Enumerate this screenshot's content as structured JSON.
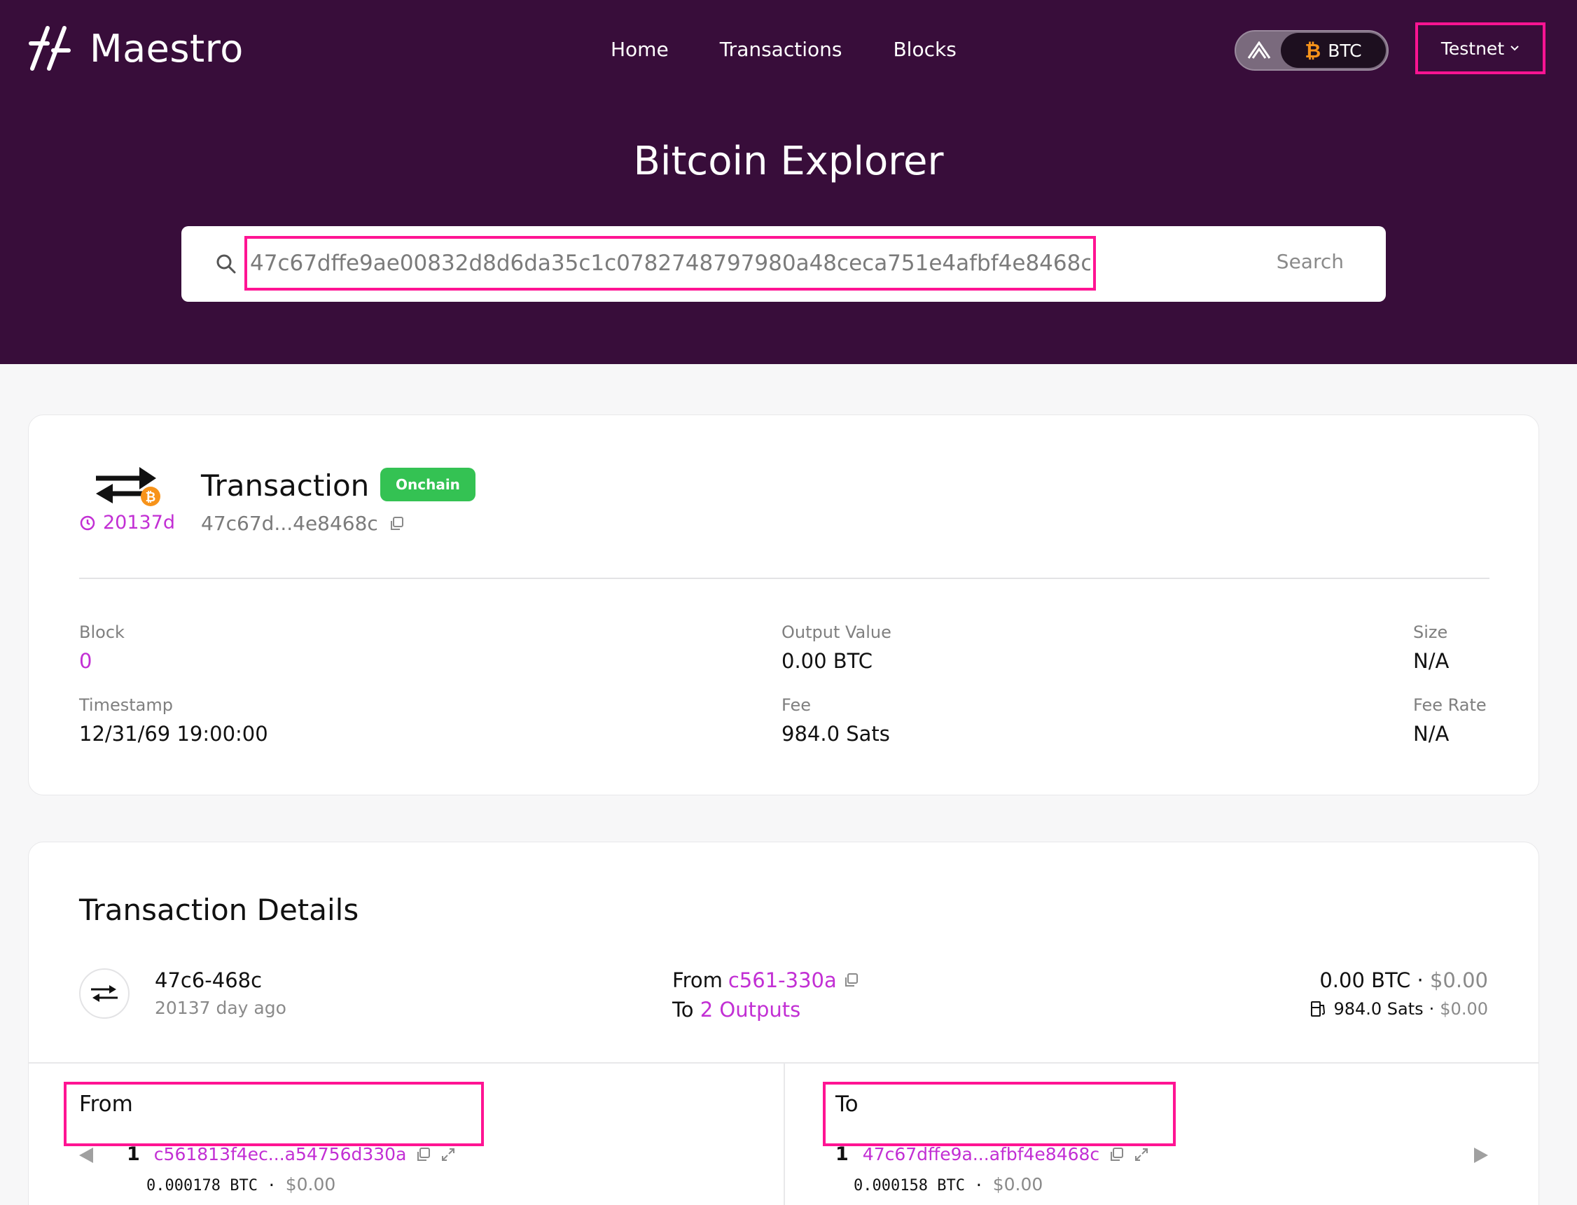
{
  "brand": {
    "name": "Maestro"
  },
  "nav": {
    "home": "Home",
    "transactions": "Transactions",
    "blocks": "Blocks"
  },
  "chain_toggle": {
    "selected": "BTC"
  },
  "network": {
    "selected": "Testnet"
  },
  "page_title": "Bitcoin Explorer",
  "search": {
    "value": "47c67dffe9ae00832d8d6da35c1c0782748797980a48ceca751e4afbf4e8468c",
    "button": "Search"
  },
  "transaction": {
    "title": "Transaction",
    "badge": "Onchain",
    "age": "20137d",
    "hash_short": "47c67d...4e8468c",
    "fields": {
      "block_label": "Block",
      "block_value": "0",
      "timestamp_label": "Timestamp",
      "timestamp_value": "12/31/69 19:00:00",
      "output_label": "Output Value",
      "output_value": "0.00 BTC",
      "fee_label": "Fee",
      "fee_value": "984.0 Sats",
      "size_label": "Size",
      "size_value": "N/A",
      "feerate_label": "Fee Rate",
      "feerate_value": "N/A"
    }
  },
  "details": {
    "title": "Transaction Details",
    "row": {
      "hash": "47c6-468c",
      "ago": "20137 day ago",
      "from_label": "From",
      "from_value": "c561-330a",
      "to_label": "To",
      "to_value": "2 Outputs",
      "amount": "0.00 BTC",
      "amount_usd": "$0.00",
      "fee": "984.0 Sats",
      "fee_usd": "$0.00",
      "sep": "·"
    },
    "from": {
      "title": "From",
      "index": "1",
      "address": "c561813f4ec...a54756d330a",
      "amount": "0.000178 BTC",
      "usd": "$0.00"
    },
    "to": {
      "title": "To",
      "index": "1",
      "address": "47c67dffe9a...afbf4e8468c",
      "amount": "0.000158 BTC",
      "usd": "$0.00"
    }
  },
  "colors": {
    "header_bg": "#380d3a",
    "accent": "#c22fd4",
    "badge": "#34c253",
    "highlight": "#ff1493",
    "btc": "#f7931a"
  }
}
